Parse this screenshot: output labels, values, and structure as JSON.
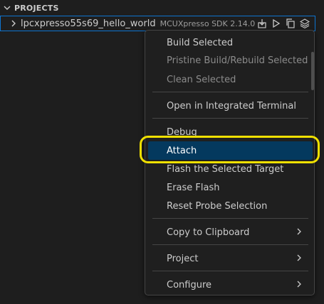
{
  "section": {
    "title": "PROJECTS"
  },
  "project": {
    "name": "lpcxpresso55s69_hello_world",
    "description": "MCUXpresso SDK 2.14.0",
    "actions": [
      "build-icon",
      "run-icon",
      "copy-icon",
      "layers-icon"
    ]
  },
  "menu": {
    "items": [
      {
        "label": "Build Selected",
        "disabled": false
      },
      {
        "label": "Pristine Build/Rebuild Selected",
        "disabled": true
      },
      {
        "label": "Clean Selected",
        "disabled": true
      },
      {
        "label": "Open in Integrated Terminal",
        "disabled": false
      },
      {
        "label": "Debug",
        "disabled": false
      },
      {
        "label": "Attach",
        "disabled": false,
        "active": true
      },
      {
        "label": "Flash the Selected Target",
        "disabled": false
      },
      {
        "label": "Erase Flash",
        "disabled": false
      },
      {
        "label": "Reset Probe Selection",
        "disabled": false
      },
      {
        "label": "Copy to Clipboard",
        "disabled": false,
        "submenu": true
      },
      {
        "label": "Project",
        "disabled": false,
        "submenu": true
      },
      {
        "label": "Configure",
        "disabled": false,
        "submenu": true
      }
    ]
  },
  "colors": {
    "accent_border": "#0e74d0",
    "active_bg": "#04395e",
    "highlight_ring": "#f0e000"
  }
}
